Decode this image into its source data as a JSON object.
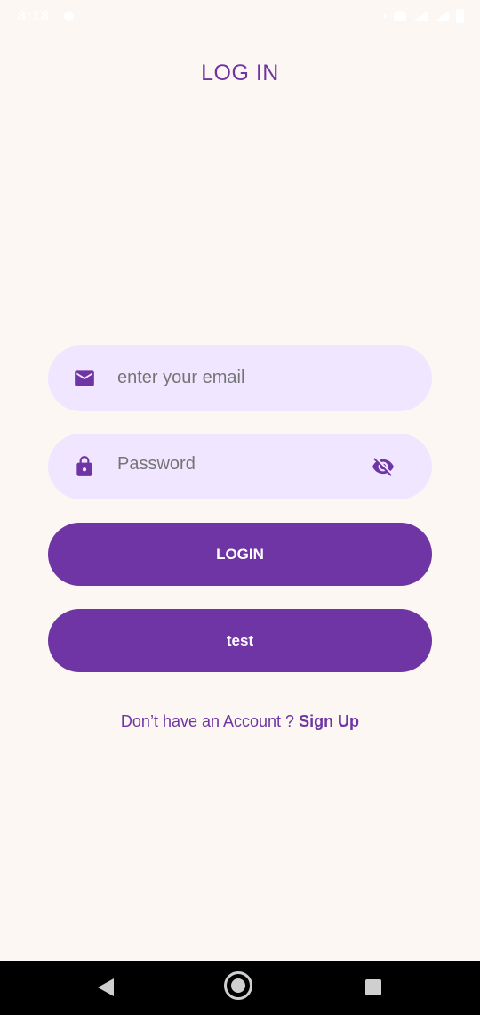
{
  "status_bar": {
    "time": "8:18"
  },
  "header": {
    "title": "LOG IN"
  },
  "form": {
    "email": {
      "icon": "mail-icon",
      "placeholder": "enter your email",
      "value": ""
    },
    "password": {
      "icon": "lock-icon",
      "placeholder": "Password",
      "value": "",
      "toggle_icon": "eye-off-icon"
    }
  },
  "buttons": {
    "login_label": "LOGIN",
    "test_label": "test"
  },
  "signup": {
    "prompt": "Don’t have an Account ? ",
    "link_label": "Sign Up"
  },
  "colors": {
    "primary": "#6f35a5",
    "field_bg": "#f1e6ff",
    "page_bg": "#fcf7f2"
  },
  "nav_bar": {
    "back_icon": "back-triangle-icon",
    "home_icon": "home-circle-icon",
    "recents_icon": "recents-square-icon"
  }
}
